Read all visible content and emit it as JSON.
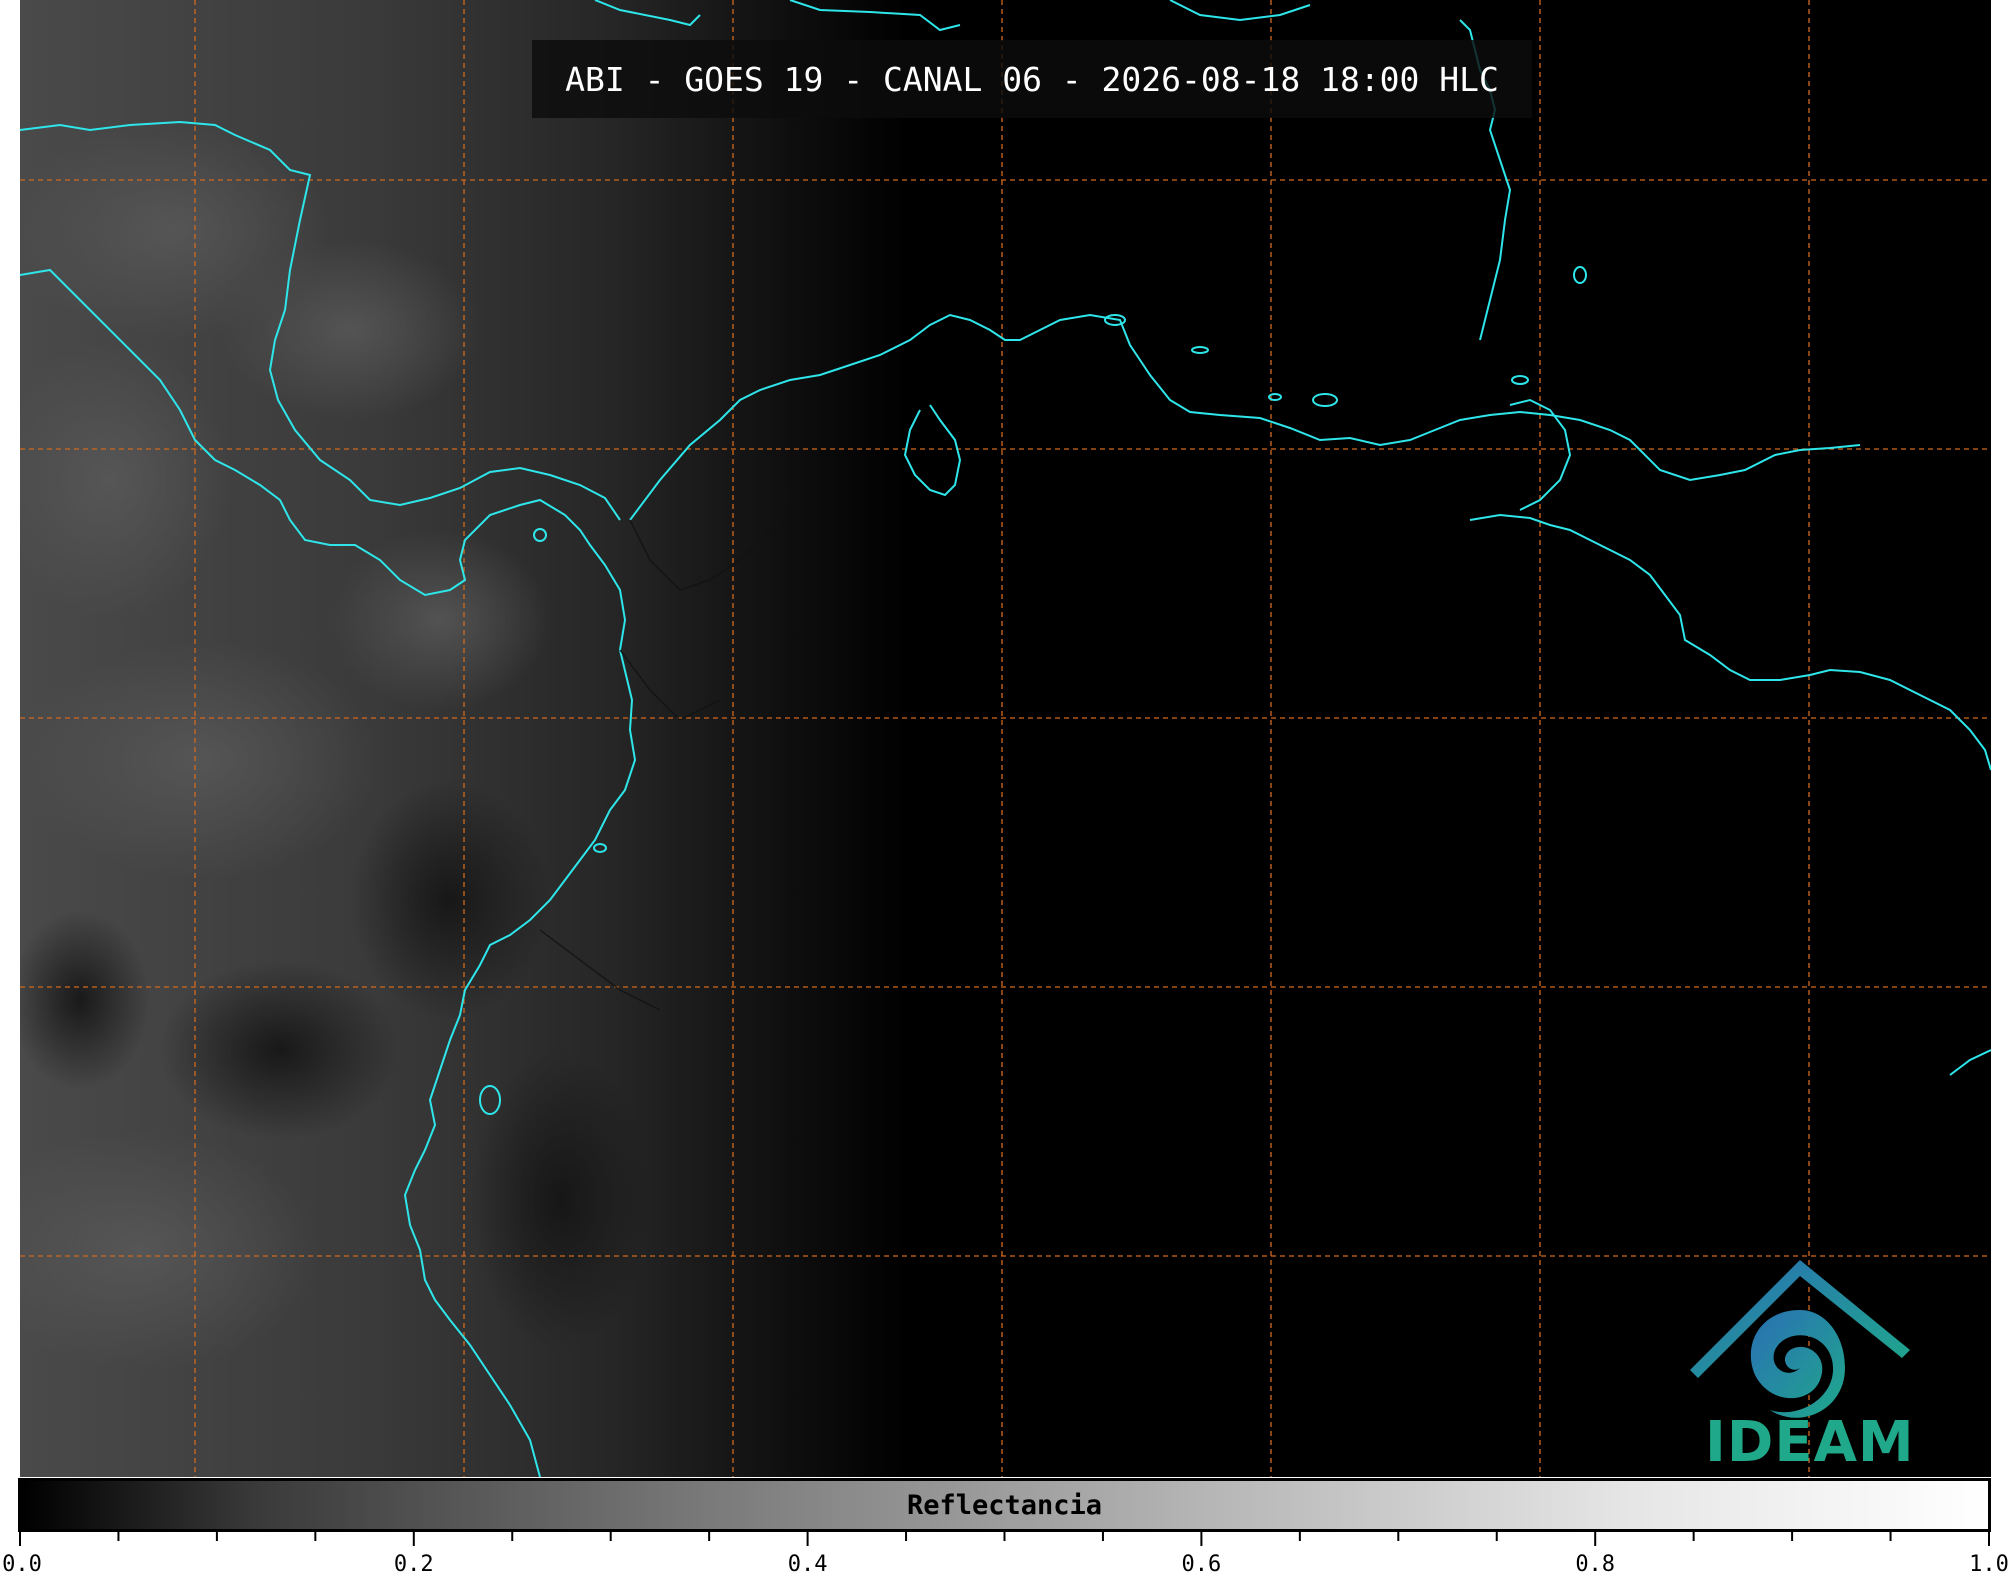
{
  "title": "ABI - GOES 19 - CANAL 06 - 2026-08-18 18:00 HLC",
  "colorbar": {
    "label": "Reflectancia",
    "min": 0.0,
    "max": 1.0,
    "major_ticks": [
      "0.0",
      "0.2",
      "0.4",
      "0.6",
      "0.8",
      "1.0"
    ],
    "minor_step": 0.05
  },
  "logo": {
    "text": "IDEAM"
  },
  "colors": {
    "coastline": "#2ee6ea",
    "gridline": "#d2691e",
    "background": "#000000",
    "logo_teal": "#1fa98a",
    "logo_blue": "#2a6fb5"
  }
}
